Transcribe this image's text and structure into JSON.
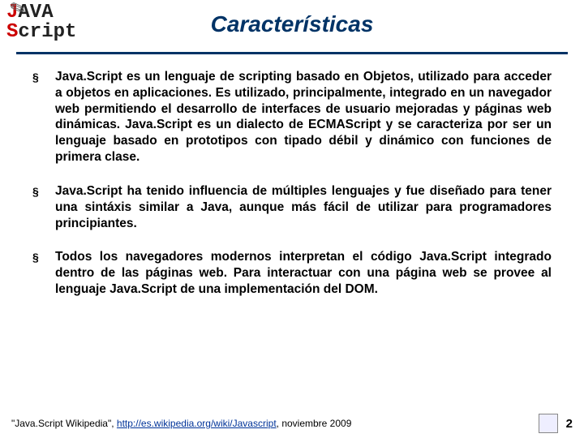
{
  "header": {
    "logo_text_1": "J",
    "logo_text_2": "AVA",
    "logo_text_3": "S",
    "logo_text_4": "cript",
    "title": "Características"
  },
  "bullets": [
    "Java.Script es un lenguaje de scripting basado en Objetos, utilizado para acceder a objetos en aplicaciones. Es utilizado, principalmente, integrado en un navegador web permitiendo el desarrollo de interfaces de usuario mejoradas y páginas web dinámicas. Java.Script es un dialecto de ECMAScript y se caracteriza por ser un lenguaje basado en prototipos con tipado débil y dinámico con funciones de primera clase.",
    "Java.Script ha tenido influencia de múltiples lenguajes y fue diseñado para tener una sintáxis similar a Java, aunque más fácil de utilizar para programadores principiantes.",
    "Todos los navegadores modernos interpretan el código Java.Script integrado dentro de las páginas web. Para interactuar con una página web se provee al lenguaje Java.Script de una implementación del DOM."
  ],
  "footer": {
    "source_prefix": "\"Java.Script Wikipedia\", ",
    "source_url": "http://es.wikipedia.org/wiki/Javascript",
    "source_suffix": ", noviembre 2009",
    "page_number": "2"
  }
}
